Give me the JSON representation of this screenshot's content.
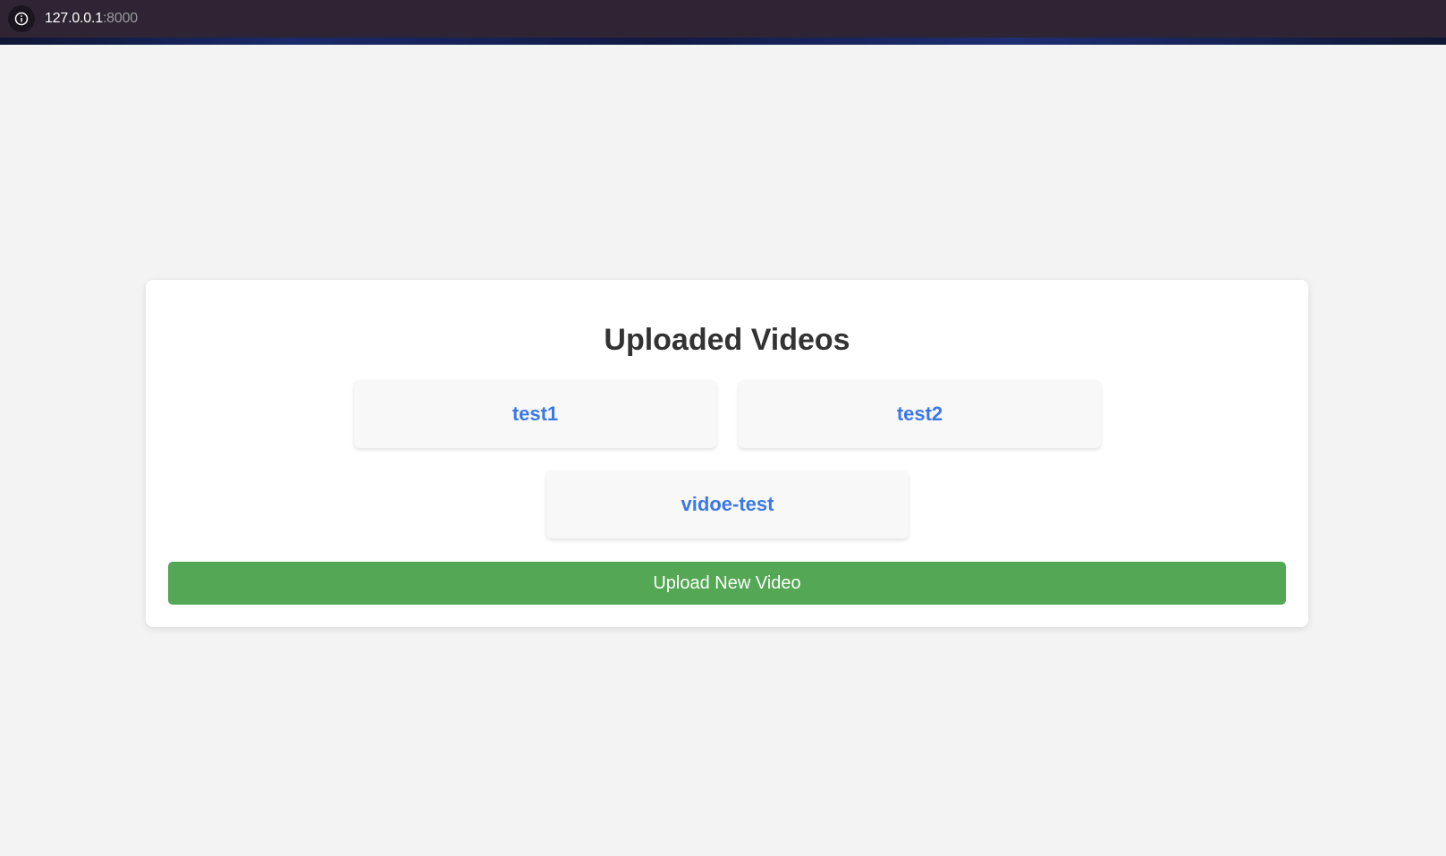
{
  "browser": {
    "url_host": "127.0.0.1",
    "url_port": ":8000",
    "info_icon": "info-icon"
  },
  "main": {
    "title": "Uploaded Videos",
    "videos": [
      {
        "label": "test1"
      },
      {
        "label": "test2"
      },
      {
        "label": "vidoe-test"
      }
    ],
    "upload_button_label": "Upload New Video"
  },
  "colors": {
    "browser_bar": "#2f2433",
    "page_bg": "#f3f3f3",
    "link": "#3b78e6",
    "upload_button": "#54a754",
    "title": "#333333"
  }
}
